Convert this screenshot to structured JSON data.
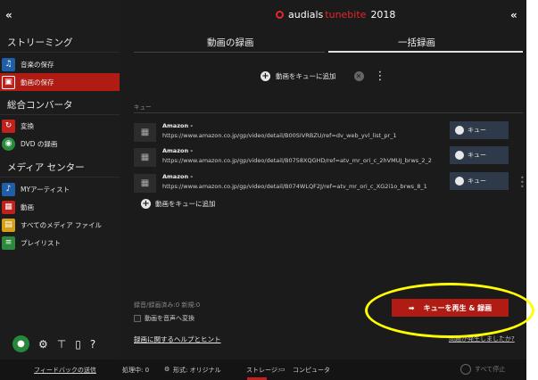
{
  "app": {
    "brand_prefix": "audials",
    "brand_accent": "tunebite",
    "brand_year": "2018",
    "collapse_left": "«",
    "collapse_right": "«"
  },
  "sidebar": {
    "sections": {
      "streaming": "ストリーミング",
      "converter": "総合コンバータ",
      "media_center": "メディア センター"
    },
    "items": [
      {
        "label": "音楽の保存",
        "icon": "music-save-icon"
      },
      {
        "label": "動画の保存",
        "icon": "video-save-icon"
      },
      {
        "label": "変換",
        "icon": "convert-icon"
      },
      {
        "label": "DVD の録画",
        "icon": "dvd-icon"
      },
      {
        "label": "MYアーティスト",
        "icon": "music-note-icon"
      },
      {
        "label": "動画",
        "icon": "film-icon"
      },
      {
        "label": "すべてのメディア ファイル",
        "icon": "files-icon"
      },
      {
        "label": "プレイリスト",
        "icon": "playlist-icon"
      }
    ],
    "help_char": "?"
  },
  "main": {
    "tabs": [
      {
        "label": "動画の録画"
      },
      {
        "label": "一括録画"
      }
    ],
    "toolbar": {
      "add_label": "動画をキューに追加"
    },
    "queue_label": "キュー",
    "queue": [
      {
        "title": "Amazon -",
        "url": "https://www.amazon.co.jp/gp/video/detail/B00SIVRBZU/ref=dv_web_yvl_list_pr_1",
        "button": "キュー"
      },
      {
        "title": "Amazon -",
        "url": "https://www.amazon.co.jp/gp/video/detail/B0758XQGHD/ref=atv_mr_ori_c_2hVMUJ_brws_2_2",
        "button": "キュー"
      },
      {
        "title": "Amazon -",
        "url": "https://www.amazon.co.jp/gp/video/detail/B074WLQF2J/ref=atv_mr_ori_c_XG2i1o_brws_8_1",
        "button": "キュー"
      }
    ],
    "add_link": "動画をキューに追加",
    "stats": "録音/録画済み:0   新規:0",
    "convert_label": "動画を音声へ変換",
    "help_link": "録画に関するヘルプとヒント",
    "problem_link": "問題が発生しましたか?",
    "play_button": "キューを再生 & 録画"
  },
  "status": {
    "feedback": "フィードバックの送信",
    "processing": "処理中: 0",
    "format": "形式: オリジナル",
    "storage": "ストレージ:",
    "computer": "コンピュータ",
    "stop_all": "すべて停止"
  },
  "colors": {
    "accent_red": "#b01c13",
    "highlight": "#ffff00",
    "queue_button": "#2e3a49"
  }
}
